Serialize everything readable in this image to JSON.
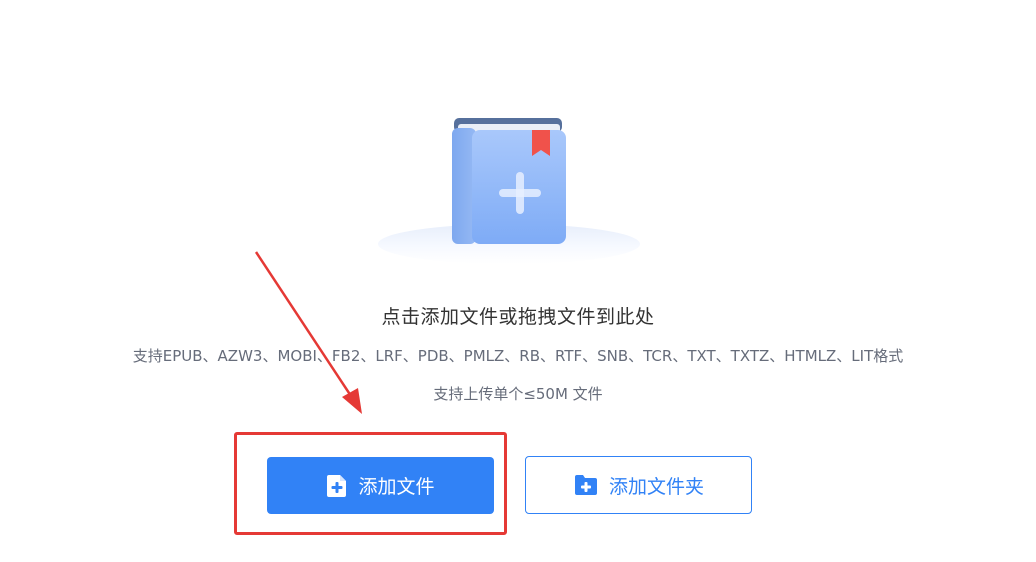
{
  "upload": {
    "heading": "点击添加文件或拖拽文件到此处",
    "formats": "支持EPUB、AZW3、MOBI、FB2、LRF、PDB、PMLZ、RB、RTF、SNB、TCR、TXT、TXTZ、HTMLZ、LIT格式",
    "size_note": "支持上传单个≤50M 文件"
  },
  "buttons": {
    "add_file_label": "添加文件",
    "add_folder_label": "添加文件夹"
  },
  "icons": {
    "book": "book-add-icon",
    "file": "file-add-icon",
    "folder": "folder-add-icon"
  },
  "colors": {
    "accent": "#3182f6",
    "highlight": "#e53935",
    "bookmark": "#f0524b"
  }
}
